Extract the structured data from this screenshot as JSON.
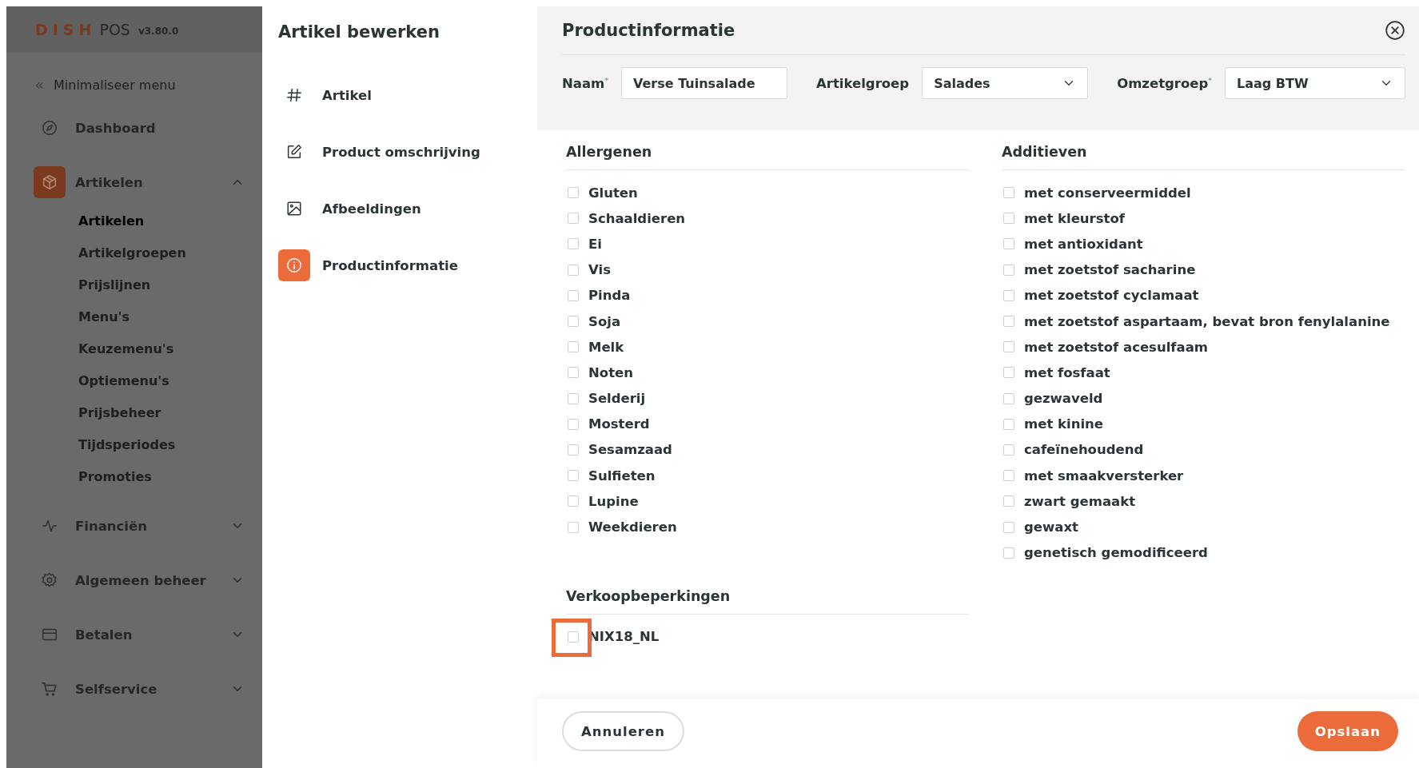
{
  "sidebar": {
    "brand": "DISH",
    "product": "POS",
    "version": "v3.80.0",
    "minimize_label": "Minimaliseer menu",
    "items": [
      {
        "label": "Dashboard",
        "kind": "link",
        "selected": false
      },
      {
        "label": "Artikelen",
        "kind": "group",
        "selected": true,
        "expanded": true,
        "children": [
          {
            "label": "Artikelen",
            "selected": true
          },
          {
            "label": "Artikelgroepen",
            "selected": false
          },
          {
            "label": "Prijslijnen",
            "selected": false
          },
          {
            "label": "Menu's",
            "selected": false
          },
          {
            "label": "Keuzemenu's",
            "selected": false
          },
          {
            "label": "Optiemenu's",
            "selected": false
          },
          {
            "label": "Prijsbeheer",
            "selected": false
          },
          {
            "label": "Tijdsperiodes",
            "selected": false
          },
          {
            "label": "Promoties",
            "selected": false
          }
        ]
      },
      {
        "label": "Financiën",
        "kind": "group",
        "selected": false,
        "expanded": false
      },
      {
        "label": "Algemeen beheer",
        "kind": "group",
        "selected": false,
        "expanded": false
      },
      {
        "label": "Betalen",
        "kind": "group",
        "selected": false,
        "expanded": false
      },
      {
        "label": "Selfservice",
        "kind": "group",
        "selected": false,
        "expanded": false
      }
    ]
  },
  "editor": {
    "title": "Artikel bewerken",
    "sections": [
      {
        "label": "Artikel",
        "selected": false
      },
      {
        "label": "Product omschrijving",
        "selected": false
      },
      {
        "label": "Afbeeldingen",
        "selected": false
      },
      {
        "label": "Productinformatie",
        "selected": true
      }
    ]
  },
  "panel": {
    "title": "Productinformatie",
    "fields": [
      {
        "label": "Naam$^{*}$",
        "kind": "text",
        "value": "Verse Tuinsalade"
      },
      {
        "label": "Artikelgroep",
        "kind": "select",
        "value": "Salades"
      },
      {
        "label": "Omzetgroep$^{*}$",
        "kind": "select",
        "value": "Laag BTW"
      }
    ],
    "allergens": {
      "title": "Allergenen",
      "items": [
        {
          "label": "Gluten",
          "checked": false
        },
        {
          "label": "Schaaldieren",
          "checked": false
        },
        {
          "label": "Ei",
          "checked": false
        },
        {
          "label": "Vis",
          "checked": false
        },
        {
          "label": "Pinda",
          "checked": false
        },
        {
          "label": "Soja",
          "checked": false
        },
        {
          "label": "Melk",
          "checked": false
        },
        {
          "label": "Noten",
          "checked": false
        },
        {
          "label": "Selderij",
          "checked": false
        },
        {
          "label": "Mosterd",
          "checked": false
        },
        {
          "label": "Sesamzaad",
          "checked": false
        },
        {
          "label": "Sulfieten",
          "checked": false
        },
        {
          "label": "Lupine",
          "checked": false
        },
        {
          "label": "Weekdieren",
          "checked": false
        }
      ]
    },
    "additives": {
      "title": "Additieven",
      "items": [
        {
          "label": "met conserveermiddel",
          "checked": false
        },
        {
          "label": "met kleurstof",
          "checked": false
        },
        {
          "label": "met antioxidant",
          "checked": false
        },
        {
          "label": "met zoetstof sacharine",
          "checked": false
        },
        {
          "label": "met zoetstof cyclamaat",
          "checked": false
        },
        {
          "label": "met zoetstof aspartaam, bevat bron fenylalanine",
          "checked": false
        },
        {
          "label": "met zoetstof acesulfaam",
          "checked": false
        },
        {
          "label": "met fosfaat",
          "checked": false
        },
        {
          "label": "gezwaveld",
          "checked": false
        },
        {
          "label": "met kinine",
          "checked": false
        },
        {
          "label": "cafeïnehoudend",
          "checked": false
        },
        {
          "label": "met smaakversterker",
          "checked": false
        },
        {
          "label": "zwart gemaakt",
          "checked": false
        },
        {
          "label": "gewaxt",
          "checked": false
        },
        {
          "label": "genetisch gemodificeerd",
          "checked": false
        }
      ]
    },
    "restrictions": {
      "title": "Verkoopbeperkingen",
      "items": [
        {
          "label": "NIX18_NL",
          "checked": false,
          "highlighted": true
        }
      ]
    },
    "cancel_label": "Annuleren",
    "save_label": "Opslaan"
  }
}
